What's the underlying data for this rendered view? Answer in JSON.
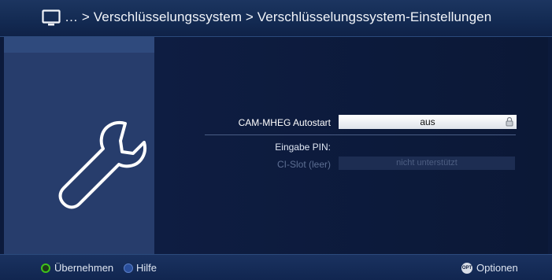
{
  "header": {
    "tv_icon": "tv-icon",
    "breadcrumb": "… > Verschlüsselungssystem > Verschlüsselungssystem-Einstellungen"
  },
  "sidebar": {
    "icon": "wrench-icon"
  },
  "settings": {
    "cam_mheg": {
      "label": "CAM-MHEG Autostart",
      "value": "aus"
    },
    "pin": {
      "label": "Eingabe PIN:"
    },
    "ci_slot": {
      "label": "CI-Slot (leer)",
      "value": "nicht unterstützt"
    }
  },
  "footer": {
    "ok_label": "Übernehmen",
    "help_label": "Hilfe",
    "opt_badge": "OPT",
    "options_label": "Optionen"
  },
  "colors": {
    "background": "#0d1a3a",
    "sidebar": "#273d6c",
    "green_key": "#3fc21a",
    "blue_key": "#2a4f9c"
  }
}
